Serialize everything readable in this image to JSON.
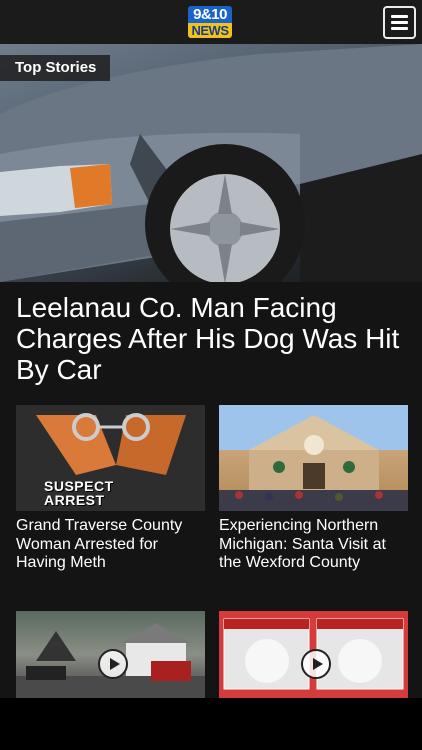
{
  "app": {
    "logo_line1": "9&10",
    "logo_line2": "NEWS",
    "accent_blue": "#1a63c9",
    "accent_yellow": "#f2c21b",
    "menu_icon": "hamburger-menu-icon"
  },
  "hero": {
    "section_label": "Top Stories",
    "headline": "Leelanau Co. Man Facing Charges After His Dog Was Hit By Car"
  },
  "stories": [
    {
      "title": "Grand Traverse County Woman Arrested for Having Meth",
      "thumb_caption_line1": "SUSPECT",
      "thumb_caption_line2": "ARREST"
    },
    {
      "title": "Experiencing Northern Michigan: Santa Visit at the Wexford County"
    }
  ],
  "videos": [
    {
      "play_icon": "play-icon"
    },
    {
      "play_icon": "play-icon"
    }
  ]
}
